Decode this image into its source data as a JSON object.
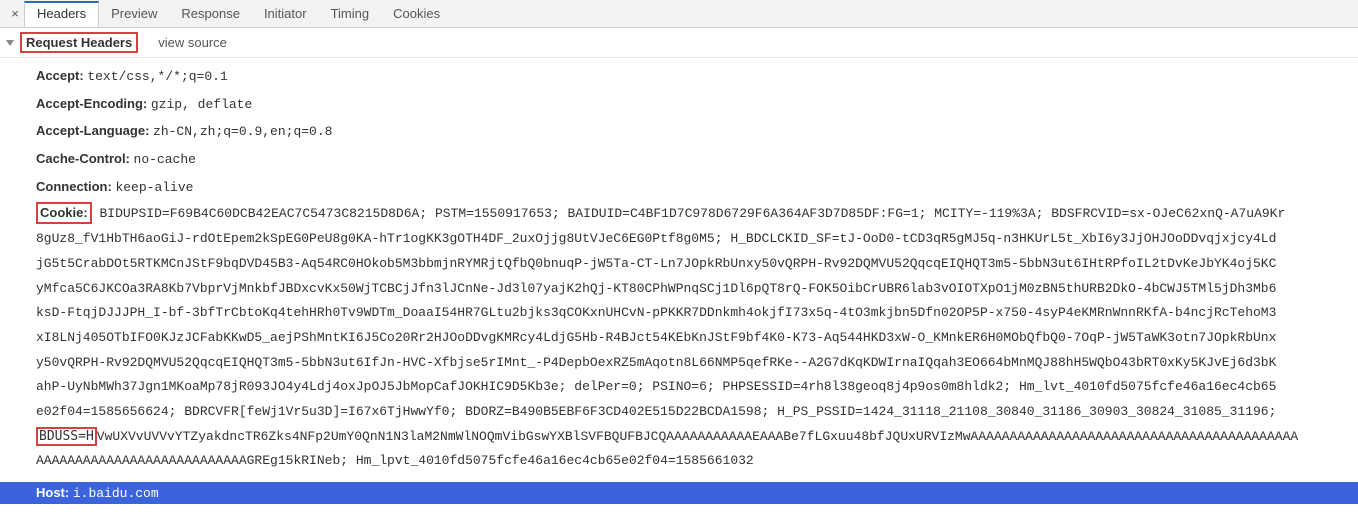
{
  "tabs": {
    "close": "×",
    "items": [
      "Headers",
      "Preview",
      "Response",
      "Initiator",
      "Timing",
      "Cookies"
    ],
    "activeIndex": 0
  },
  "section": {
    "title": "Request Headers",
    "view_source": "view source"
  },
  "headers": {
    "accept": {
      "name": "Accept:",
      "value": "text/css,*/*;q=0.1"
    },
    "accept_encoding": {
      "name": "Accept-Encoding:",
      "value": "gzip, deflate"
    },
    "accept_language": {
      "name": "Accept-Language:",
      "value": "zh-CN,zh;q=0.9,en;q=0.8"
    },
    "cache_control": {
      "name": "Cache-Control:",
      "value": "no-cache"
    },
    "connection": {
      "name": "Connection:",
      "value": "keep-alive"
    },
    "host": {
      "name": "Host:",
      "value": "i.baidu.com"
    }
  },
  "cookie": {
    "label": "Cookie:",
    "lines": [
      "BIDUPSID=F69B4C60DCB42EAC7C5473C8215D8D6A; PSTM=1550917653; BAIDUID=C4BF1D7C978D6729F6A364AF3D7D85DF:FG=1; MCITY=-119%3A; BDSFRCVID=sx-OJeC62xnQ-A7uA9Kr",
      "8gUz8_fV1HbTH6aoGiJ-rdOtEpem2kSpEG0PeU8g0KA-hTr1ogKK3gOTH4DF_2uxOjjg8UtVJeC6EG0Ptf8g0M5; H_BDCLCKID_SF=tJ-OoD0-tCD3qR5gMJ5q-n3HKUrL5t_XbI6y3JjOHJOoDDvqjxjcy4Ld",
      "jG5t5CrabDOt5RTKMCnJStF9bqDVD45B3-Aq54RC0HOkob5M3bbmjnRYMRjtQfbQ0bnuqP-jW5Ta-CT-Ln7JOpkRbUnxy50vQRPH-Rv92DQMVU52QqcqEIQHQT3m5-5bbN3ut6IHtRPfoIL2tDvKeJbYK4oj5KC",
      "yMfca5C6JKCOa3RA8Kb7VbprVjMnkbfJBDxcvKx50WjTCBCjJfn3lJCnNe-Jd3l07yajK2hQj-KT80CPhWPnqSCj1Dl6pQT8rQ-FOK5OibCrUBR6lab3vOIOTXpO1jM0zBN5thURB2DkO-4bCWJ5TMl5jDh3Mb6",
      "ksD-FtqjDJJJPH_I-bf-3bfTrCbtoKq4tehHRh0Tv9WDTm_DoaaI54HR7GLtu2bjks3qCOKxnUHCvN-pPKKR7DDnkmh4okjfI73x5q-4tO3mkjbn5Dfn02OP5P-x750-4syP4eKMRnWnnRKfA-b4ncjRcTehoM3",
      "xI8LNj405OTbIFO0KJzJCFabKKwD5_aejPShMntKI6J5Co20Rr2HJOoDDvgKMRcy4LdjG5Hb-R4BJct54KEbKnJStF9bf4K0-K73-Aq544HKD3xW-O_KMnkER6H0MObQfbQ0-7OqP-jW5TaWK3otn7JOpkRbUnx",
      "y50vQRPH-Rv92DQMVU52QqcqEIQHQT3m5-5bbN3ut6IfJn-HVC-Xfbjse5rIMnt_-P4DepbOexRZ5mAqotn8L66NMP5qefRKe--A2G7dKqKDWIrnaIQqah3EO664bMnMQJ88hH5WQbO43bRT0xKy5KJvEj6d3bK",
      "ahP-UyNbMWh37Jgn1MKoaMp78jR093JO4y4Ldj4oxJpOJ5JbMopCafJOKHIC9D5Kb3e; delPer=0; PSINO=6; PHPSESSID=4rh8l38geoq8j4p9os0m8hldk2; Hm_lvt_4010fd5075fcfe46a16ec4cb65",
      "e02f04=1585656624; BDRCVFR[feWj1Vr5u3D]=I67x6TjHwwYf0; BDORZ=B490B5EBF6F3CD402E515D22BCDA1598; H_PS_PSSID=1424_31118_21108_30840_31186_30903_30824_31085_31196;"
    ],
    "bduss_key": "BDUSS=H",
    "line_after_bduss": "VwUXVvUVVvYTZyakdncTR6Zks4NFp2UmY0QnN1N3laM2NmWlNOQmVibGswYXBlSVFBQUFBJCQAAAAAAAAAAAEAAABe7fLGxuu48bfJQUxURVIzMwAAAAAAAAAAAAAAAAAAAAAAAAAAAAAAAAAAAAAAAAAA",
    "line_final": "AAAAAAAAAAAAAAAAAAAAAAAAAAAGREg15kRINeb; Hm_lpvt_4010fd5075fcfe46a16ec4cb65e02f04=1585661032"
  }
}
